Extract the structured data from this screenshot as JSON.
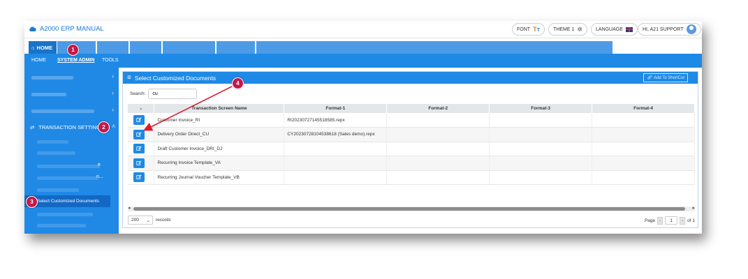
{
  "header": {
    "app_title": "A2000 ERP MANUAL",
    "font_label": "FONT",
    "theme_label": "THEME 1",
    "language_label": "LANGUAGE",
    "user_greeting": "HI, A21 SUPPORT"
  },
  "nav": {
    "home_tab": "HOME",
    "subnav": [
      "HOME",
      "SYSTEM ADMIN",
      "TOOLS"
    ]
  },
  "sidebar": {
    "transaction_setting": "TRANSACTION SETTING",
    "selected_item": "Select Customized Documents",
    "fragment_1": "e",
    "fragment_2": "n..."
  },
  "panel": {
    "title": "Select Customized Documents",
    "shortcut_label": "Add To ShortCut",
    "search_label": "Search:",
    "search_value": "cu"
  },
  "table": {
    "sort_indicator": "▲",
    "columns": [
      "Transaction Screen Name",
      "Format-1",
      "Format-2",
      "Format-3",
      "Format-4"
    ],
    "rows": [
      [
        "Customer Invoice_RI",
        "RI20230727145518585.repx",
        "",
        "",
        ""
      ],
      [
        "Delivery Order Direct_CU",
        "CY20230728104538618 (Sales demo).repx",
        "",
        "",
        ""
      ],
      [
        "Draft Customer Invoice_DRI_DJ",
        "",
        "",
        "",
        ""
      ],
      [
        "Recurring Invoice Template_VA",
        "",
        "",
        "",
        ""
      ],
      [
        "Recurring Journal Voucher Template_VB",
        "",
        "",
        "",
        ""
      ]
    ]
  },
  "footer": {
    "page_size": "200",
    "records_label": "records",
    "page_label": "Page",
    "page_value": "1",
    "of_label": "of 1"
  },
  "callouts": [
    "1",
    "2",
    "3",
    "4"
  ],
  "colors": {
    "primary": "#1e8ae6",
    "badge": "#c2194b",
    "arrow": "#e0182c"
  }
}
